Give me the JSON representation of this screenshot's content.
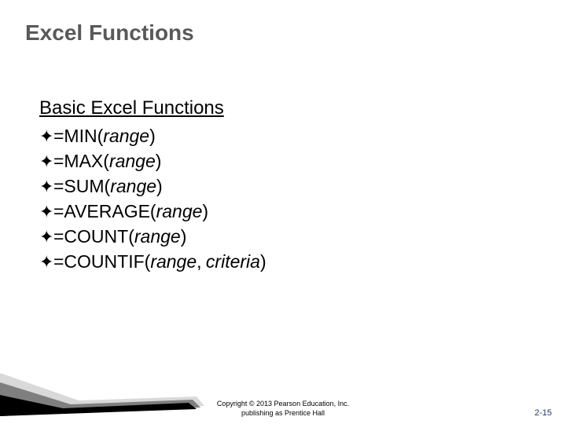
{
  "title": "Excel Functions",
  "subheading": "Basic Excel Functions",
  "bullets": [
    {
      "prefix": "=MIN(",
      "arg": "range",
      "suffix": ")"
    },
    {
      "prefix": "=MAX(",
      "arg": "range",
      "suffix": ")"
    },
    {
      "prefix": "=SUM(",
      "arg": "range",
      "suffix": ")"
    },
    {
      "prefix": "=AVERAGE(",
      "arg": "range",
      "suffix": ")"
    },
    {
      "prefix": "=COUNT(",
      "arg": "range",
      "suffix": ")"
    },
    {
      "prefix": "=COUNTIF(",
      "arg": "range",
      "sep": ",",
      "arg2": "criteria",
      "suffix": ")"
    }
  ],
  "copyright_line1": "Copyright © 2013 Pearson Education, Inc.",
  "copyright_line2": "publishing as Prentice Hall",
  "page_number": "2-15",
  "bullet_glyph": "✦"
}
